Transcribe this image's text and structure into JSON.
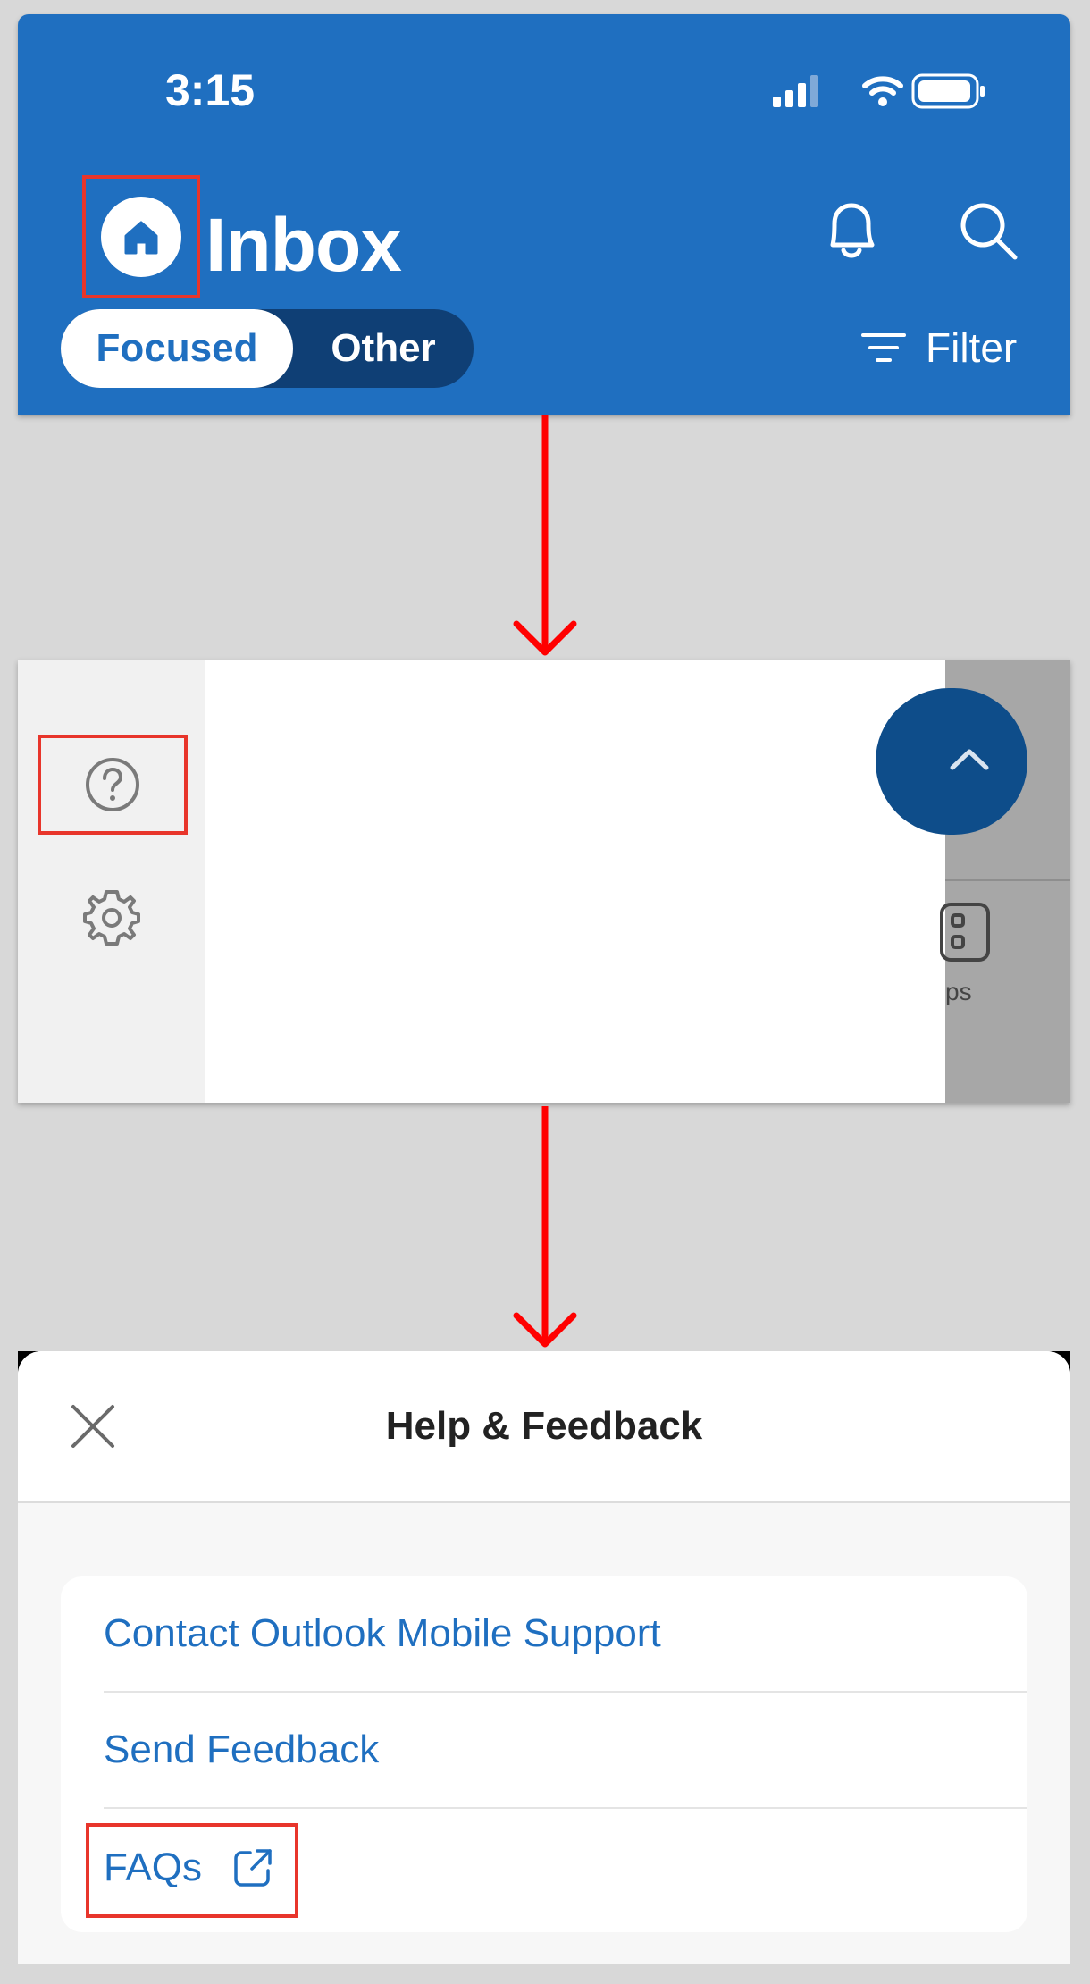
{
  "inbox": {
    "time": "3:15",
    "title": "Inbox",
    "tabs": {
      "focused": "Focused",
      "other": "Other"
    },
    "filter_label": "Filter"
  },
  "drawer": {
    "apps_label_partial": "ps"
  },
  "help_sheet": {
    "title": "Help & Feedback",
    "items": [
      {
        "label": "Contact Outlook Mobile Support"
      },
      {
        "label": "Send Feedback"
      },
      {
        "label": "FAQs"
      }
    ]
  },
  "colors": {
    "brand_blue": "#1f6fc0",
    "highlight_red": "#e8352b",
    "arrow_red": "#ff0000"
  }
}
